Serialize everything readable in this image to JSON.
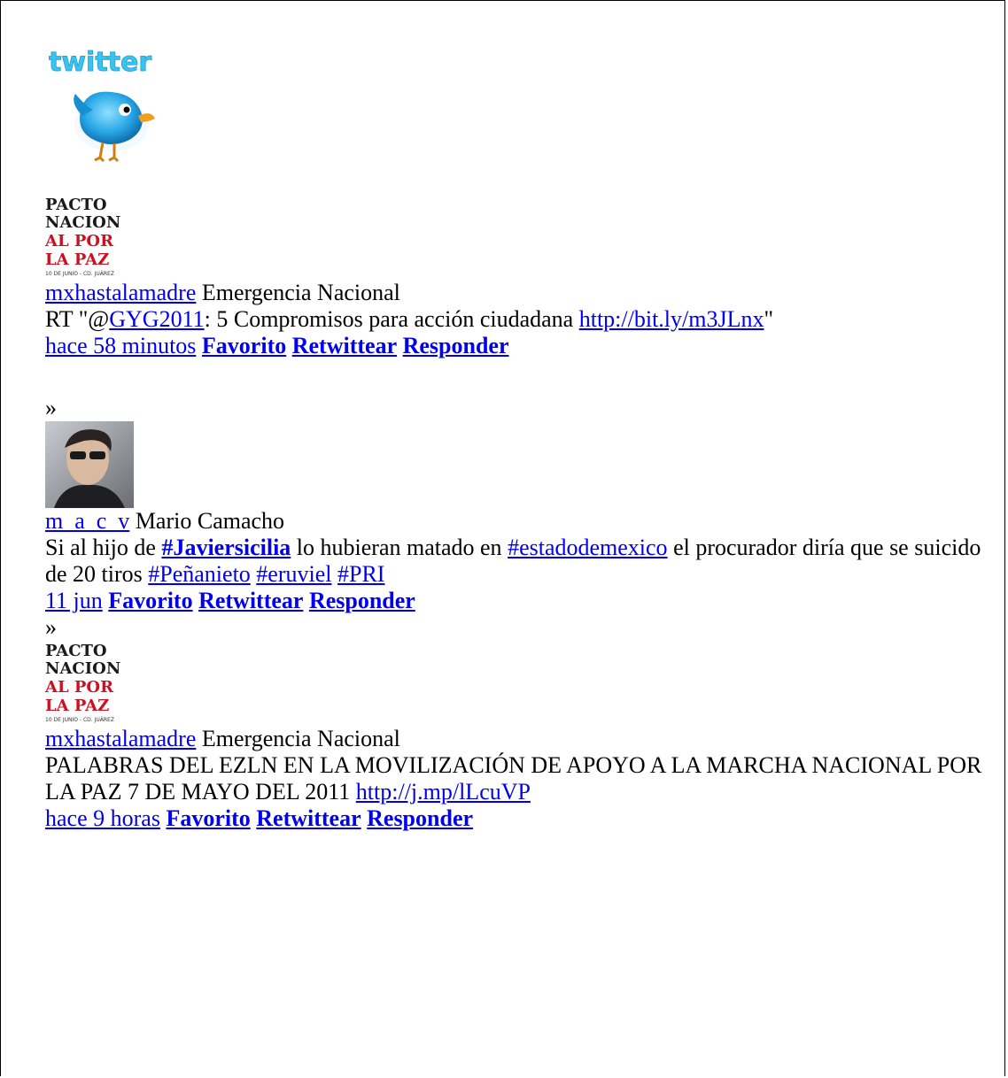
{
  "header": {
    "logo_text": "twitter"
  },
  "tweets": [
    {
      "avatar_lines": [
        "PACTO",
        "NACION",
        "AL POR",
        "LA PAZ",
        "10 DE JUNIO - CD. JUÁREZ"
      ],
      "username": "mxhastalamadre",
      "display_name": "Emergencia Nacional",
      "text_prefix": "RT \"@",
      "mention": "GYG2011",
      "text_middle": ": 5 Compromisos para acción ciudadana ",
      "link": "http://bit.ly/m3JLnx",
      "text_suffix": "\"",
      "time": "hace 58 minutos",
      "actions": [
        "Favorito",
        "Retwittear",
        "Responder"
      ]
    },
    {
      "separator": "»",
      "username": "m_a_c_v",
      "display_name": "Mario Camacho",
      "text_part1": "Si al hijo de ",
      "hashtag_bold": "#Javiersicilia",
      "text_part2": " lo hubieran matado en ",
      "hashtag_1": "#estadodemexico",
      "text_part3": " el procurador diría que se suicido de 20 tiros ",
      "hashtag_2": "#Peñanieto",
      "hashtag_3": "#eruviel",
      "hashtag_4": "#PRI",
      "time": "11 jun",
      "actions": [
        "Favorito",
        "Retwittear",
        "Responder"
      ]
    },
    {
      "separator": "»",
      "avatar_lines": [
        "PACTO",
        "NACION",
        "AL POR",
        "LA PAZ",
        "10 DE JUNIO - CD. JUÁREZ"
      ],
      "username": "mxhastalamadre",
      "display_name": "Emergencia Nacional",
      "text": "PALABRAS DEL EZLN EN LA MOVILIZACIÓN DE APOYO A LA MARCHA NACIONAL POR LA PAZ 7 DE MAYO DEL 2011 ",
      "link": "http://j.mp/lLcuVP",
      "time": "hace 9 horas",
      "actions": [
        "Favorito",
        "Retwittear",
        "Responder"
      ]
    }
  ],
  "colors": {
    "link": "#0000ee",
    "twitter_blue": "#33ccff",
    "pacto_black": "#1a1a1a",
    "pacto_red": "#cc1122"
  }
}
